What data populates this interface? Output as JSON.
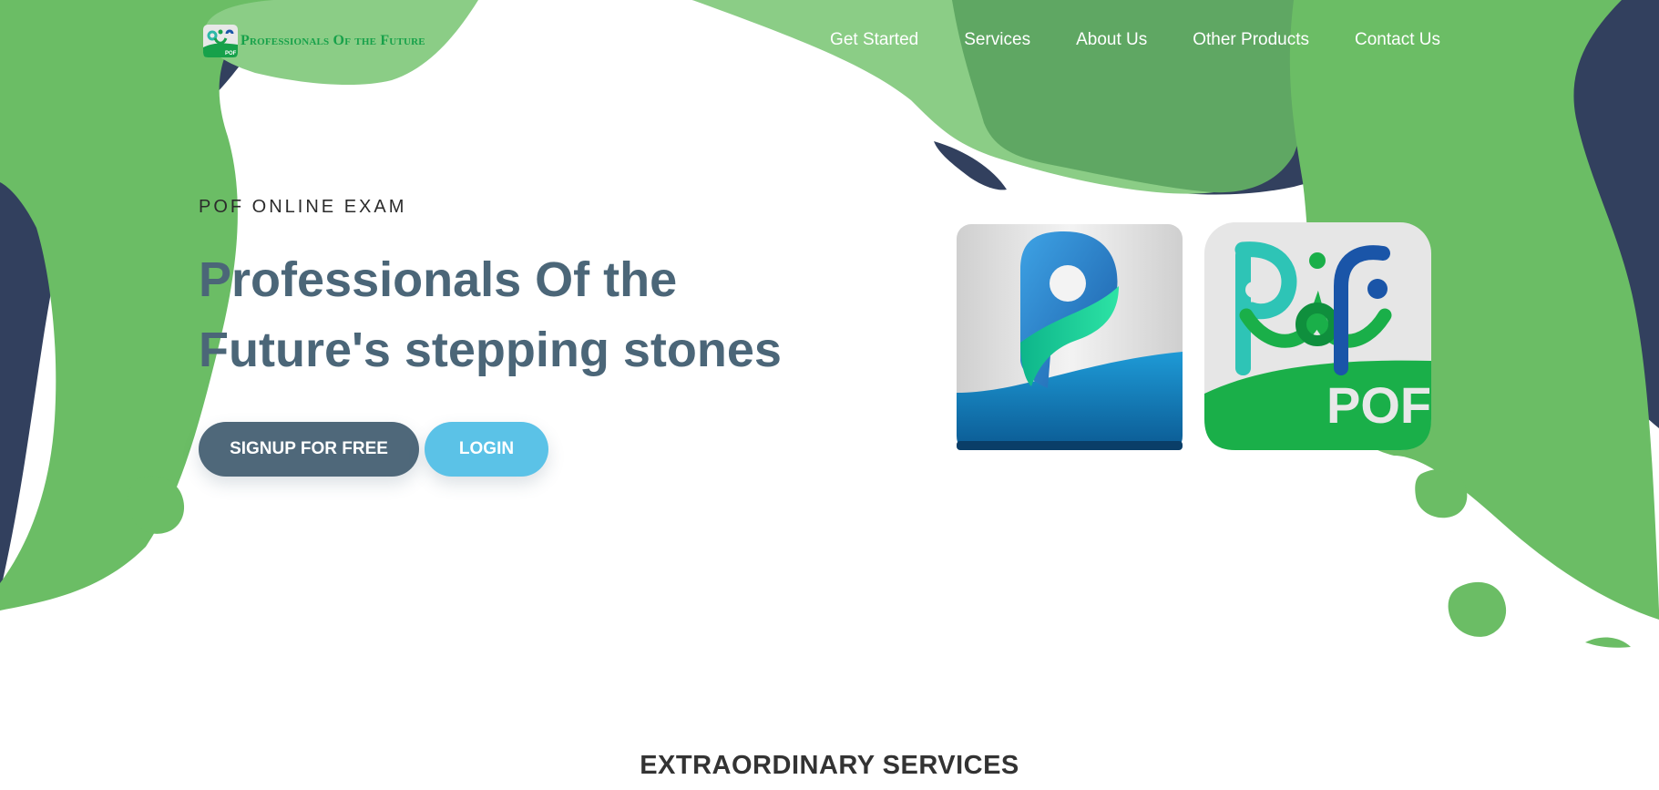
{
  "brand": {
    "logo_text": "Professionals Of the Future",
    "logo_badge_text": "POF",
    "accent": "#17a14a"
  },
  "nav": {
    "items": [
      {
        "label": "Get Started"
      },
      {
        "label": "Services"
      },
      {
        "label": "About Us"
      },
      {
        "label": "Other Products"
      },
      {
        "label": "Contact Us"
      }
    ]
  },
  "hero": {
    "kicker": "POF ONLINE EXAM",
    "headline_line1": "Professionals Of the",
    "headline_line2": "Future's stepping stones",
    "signup_label": "SIGNUP FOR FREE",
    "login_label": "LOGIN"
  },
  "products": {
    "pof_badge_text": "POF"
  },
  "services": {
    "title": "EXTRAORDINARY SERVICES"
  },
  "colors": {
    "green": "#6bbd65",
    "light_green": "#8bcd86",
    "dark_green": "#5fa763",
    "navy": "#32405e",
    "signup_bg": "#4f687a",
    "login_bg": "#5bc2e7",
    "headline": "#4b6678"
  }
}
